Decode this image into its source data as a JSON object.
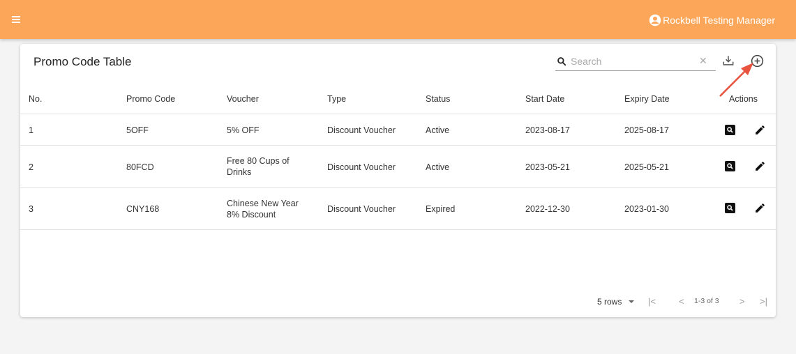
{
  "header": {
    "user_name": "Rockbell Testing Manager"
  },
  "card": {
    "title": "Promo Code Table"
  },
  "search": {
    "placeholder": "Search"
  },
  "table": {
    "columns": [
      "No.",
      "Promo Code",
      "Voucher",
      "Type",
      "Status",
      "Start Date",
      "Expiry Date",
      "Actions"
    ],
    "rows": [
      [
        "1",
        "5OFF",
        "5% OFF",
        "Discount Voucher",
        "Active",
        "2023-08-17",
        "2025-08-17"
      ],
      [
        "2",
        "80FCD",
        "Free 80 Cups of Drinks",
        "Discount Voucher",
        "Active",
        "2023-05-21",
        "2025-05-21"
      ],
      [
        "3",
        "CNY168",
        "Chinese New Year 8% Discount",
        "Discount Voucher",
        "Expired",
        "2022-12-30",
        "2023-01-30"
      ]
    ]
  },
  "pagination": {
    "rows_per_page": "5 rows",
    "range": "1-3 of 3"
  },
  "icons": {
    "menu": "hamburger-menu-icon",
    "user": "account-circle-icon",
    "search": "search-icon",
    "clear": "close-icon",
    "download": "download-icon",
    "add": "add-circle-icon",
    "view": "view-search-icon",
    "edit": "pencil-edit-icon"
  },
  "colors": {
    "accent": "#fba658",
    "annotation_arrow": "#e8533f"
  }
}
